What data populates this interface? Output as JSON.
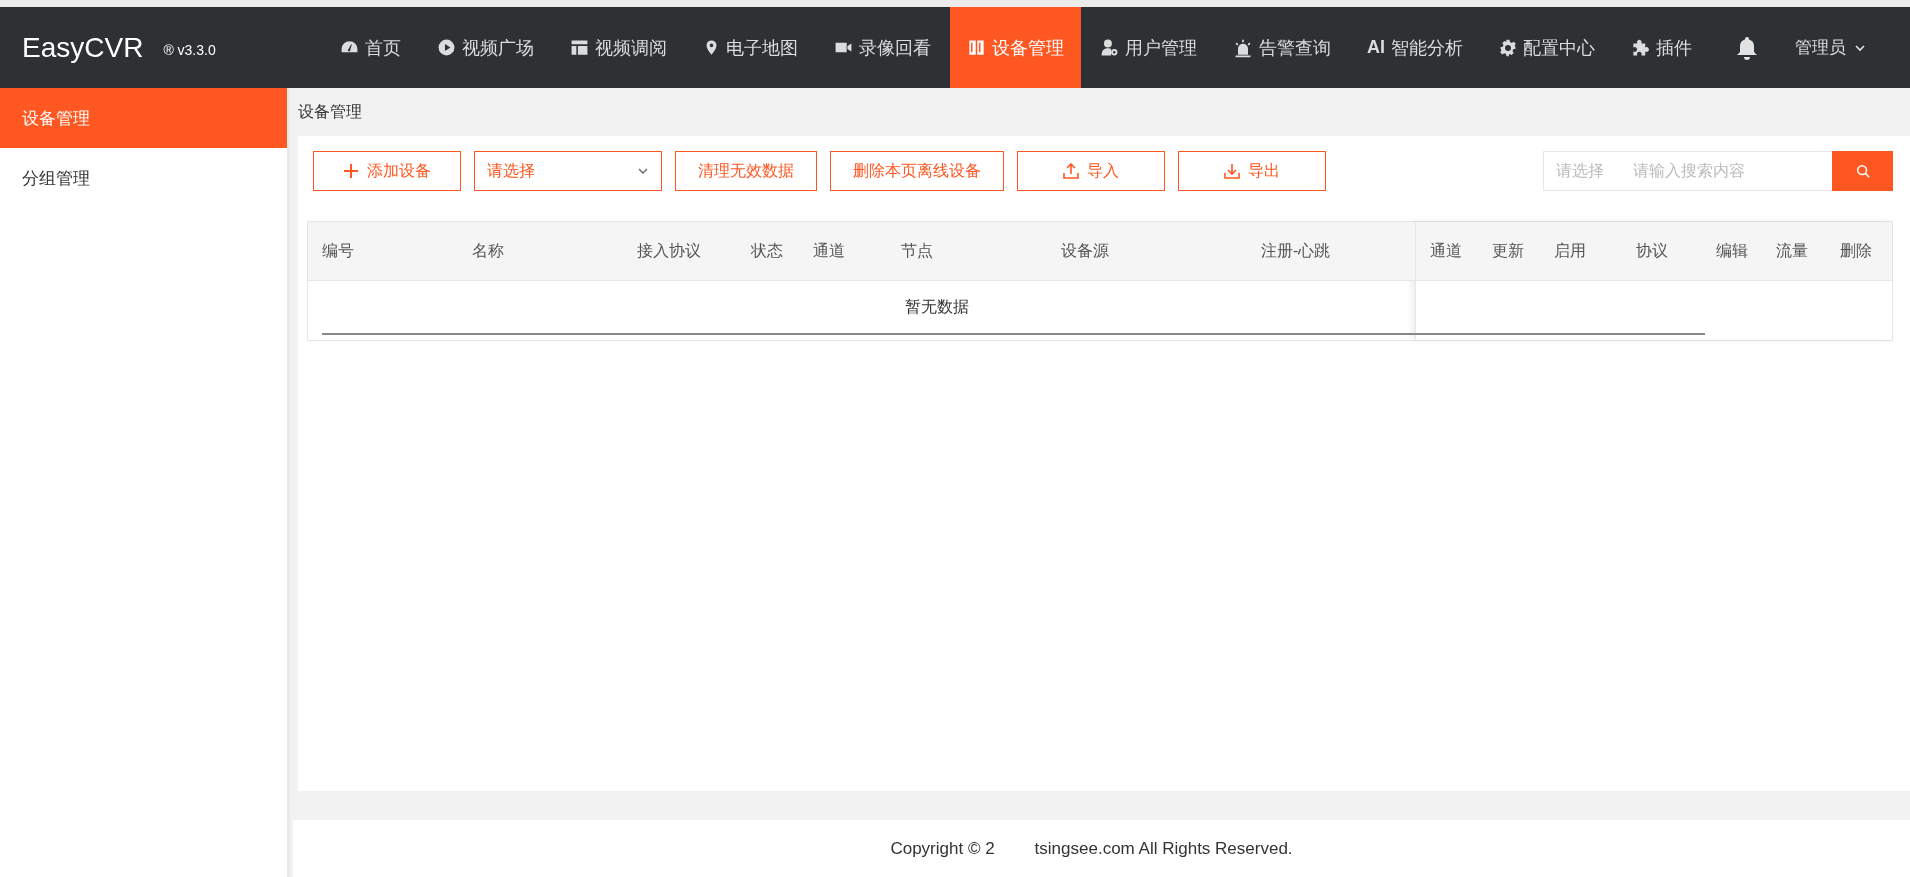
{
  "app": {
    "name": "EasyCVR",
    "version": "® v3.3.0"
  },
  "nav": [
    {
      "label": "首页",
      "selected": false
    },
    {
      "label": "视频广场",
      "selected": false
    },
    {
      "label": "视频调阅",
      "selected": false
    },
    {
      "label": "电子地图",
      "selected": false
    },
    {
      "label": "录像回看",
      "selected": false
    },
    {
      "label": "设备管理",
      "selected": true
    },
    {
      "label": "用户管理",
      "selected": false
    },
    {
      "label": "告警查询",
      "selected": false
    },
    {
      "label": "智能分析",
      "icon_text": "AI",
      "selected": false
    },
    {
      "label": "配置中心",
      "selected": false
    },
    {
      "label": "插件",
      "selected": false
    }
  ],
  "user": {
    "label": "管理员"
  },
  "sidebar": {
    "items": [
      {
        "label": "设备管理",
        "selected": true
      },
      {
        "label": "分组管理",
        "selected": false
      }
    ]
  },
  "breadcrumb": "设备管理",
  "toolbar": [
    {
      "kind": "add",
      "label": "添加设备"
    },
    {
      "kind": "select",
      "placeholder": "请选择"
    },
    {
      "kind": "button",
      "label": "清理无效数据"
    },
    {
      "kind": "button",
      "label": "删除本页离线设备"
    },
    {
      "kind": "import",
      "label": "导入"
    },
    {
      "kind": "export",
      "label": "导出"
    }
  ],
  "search": {
    "scope_placeholder": "请选择",
    "placeholder": "请输入搜索内容"
  },
  "table": {
    "columns": [
      "编号",
      "名称",
      "接入协议",
      "状态",
      "通道",
      "节点",
      "设备源",
      "注册-心跳"
    ],
    "fixed_columns": [
      "通道",
      "更新",
      "启用",
      "协议",
      "编辑",
      "流量",
      "删除"
    ],
    "empty_text": "暂无数据"
  },
  "footer": {
    "copyright": "Copyright © 2",
    "rest": "tsingsee.com All Rights Reserved."
  }
}
